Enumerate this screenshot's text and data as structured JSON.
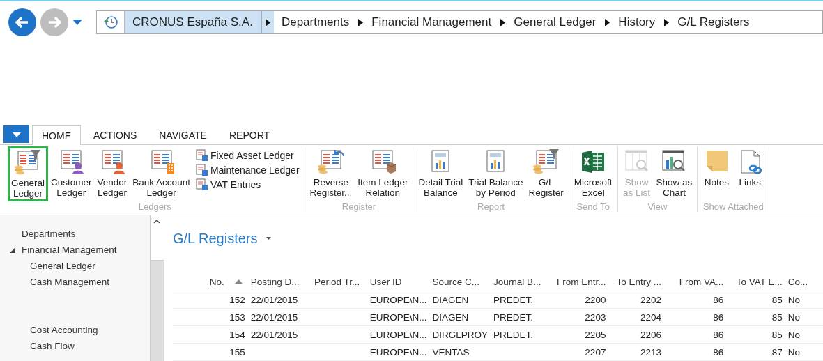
{
  "breadcrumb": [
    {
      "label": "CRONUS España S.A.",
      "selected": true
    },
    {
      "label": "Departments",
      "selected": false
    },
    {
      "label": "Financial Management",
      "selected": false
    },
    {
      "label": "General Ledger",
      "selected": false
    },
    {
      "label": "History",
      "selected": false
    },
    {
      "label": "G/L Registers",
      "selected": false
    }
  ],
  "tabs": [
    {
      "label": "HOME",
      "selected": true
    },
    {
      "label": "ACTIONS",
      "selected": false
    },
    {
      "label": "NAVIGATE",
      "selected": false
    },
    {
      "label": "REPORT",
      "selected": false
    }
  ],
  "ribbon": {
    "groups": [
      {
        "label": "Ledgers",
        "buttons": [
          {
            "lines": [
              "General",
              "Ledger"
            ],
            "selected": true,
            "disabled": false
          },
          {
            "lines": [
              "Customer",
              "Ledger"
            ],
            "selected": false,
            "disabled": false
          },
          {
            "lines": [
              "Vendor",
              "Ledger"
            ],
            "selected": false,
            "disabled": false
          },
          {
            "lines": [
              "Bank Account",
              "Ledger"
            ],
            "selected": false,
            "disabled": false
          }
        ],
        "small_buttons": [
          "Fixed Asset Ledger",
          "Maintenance Ledger",
          "VAT Entries"
        ]
      },
      {
        "label": "Register",
        "buttons": [
          {
            "lines": [
              "Reverse",
              "Register..."
            ],
            "selected": false,
            "disabled": false
          },
          {
            "lines": [
              "Item Ledger",
              "Relation"
            ],
            "selected": false,
            "disabled": false
          }
        ]
      },
      {
        "label": "Report",
        "buttons": [
          {
            "lines": [
              "Detail Trial",
              "Balance"
            ],
            "selected": false,
            "disabled": false
          },
          {
            "lines": [
              "Trial Balance",
              "by Period"
            ],
            "selected": false,
            "disabled": false
          },
          {
            "lines": [
              "G/L",
              "Register"
            ],
            "selected": false,
            "disabled": false
          }
        ]
      },
      {
        "label": "Send To",
        "buttons": [
          {
            "lines": [
              "Microsoft",
              "Excel"
            ],
            "selected": false,
            "disabled": false
          }
        ]
      },
      {
        "label": "View",
        "buttons": [
          {
            "lines": [
              "Show",
              "as List"
            ],
            "selected": false,
            "disabled": true
          },
          {
            "lines": [
              "Show as",
              "Chart"
            ],
            "selected": false,
            "disabled": false
          }
        ]
      },
      {
        "label": "Show Attached",
        "buttons": [
          {
            "lines": [
              "Notes"
            ],
            "selected": false,
            "disabled": false
          },
          {
            "lines": [
              "Links"
            ],
            "selected": false,
            "disabled": false
          }
        ]
      }
    ]
  },
  "sidebar": {
    "items": [
      {
        "label": "Departments"
      },
      {
        "label": "Financial Management",
        "expanded": true,
        "children": [
          {
            "label": "General Ledger"
          },
          {
            "label": "Cash Management"
          },
          {
            "label": "Cost Accounting"
          },
          {
            "label": "Cash Flow"
          }
        ]
      }
    ]
  },
  "page_title": "G/L Registers",
  "table": {
    "columns": [
      {
        "label": "No.",
        "kind": "number",
        "sorted": true
      },
      {
        "label": "Posting D...",
        "kind": "text"
      },
      {
        "label": "Period Tr...",
        "kind": "text"
      },
      {
        "label": "User ID",
        "kind": "text"
      },
      {
        "label": "Source C...",
        "kind": "text"
      },
      {
        "label": "Journal B...",
        "kind": "text"
      },
      {
        "label": "From Entr...",
        "kind": "number"
      },
      {
        "label": "To Entry ...",
        "kind": "number"
      },
      {
        "label": "From VA...",
        "kind": "number"
      },
      {
        "label": "To VAT E...",
        "kind": "number"
      },
      {
        "label": "Co...",
        "kind": "text"
      }
    ],
    "rows": [
      [
        "152",
        "22/01/2015",
        null,
        "EUROPE\\N...",
        "DIAGEN",
        "PREDET.",
        "2200",
        "2202",
        "86",
        "85",
        "No"
      ],
      [
        "153",
        "22/01/2015",
        null,
        "EUROPE\\N...",
        "DIAGEN",
        "PREDET.",
        "2203",
        "2204",
        "86",
        "85",
        "No"
      ],
      [
        "154",
        "22/01/2015",
        null,
        "EUROPE\\N...",
        "DIRGLPROY",
        "PREDET.",
        "2205",
        "2206",
        "86",
        "85",
        "No"
      ],
      [
        "155",
        null,
        null,
        "EUROPE\\N...",
        "VENTAS",
        null,
        "2207",
        "2213",
        "86",
        "87",
        "No"
      ]
    ]
  }
}
